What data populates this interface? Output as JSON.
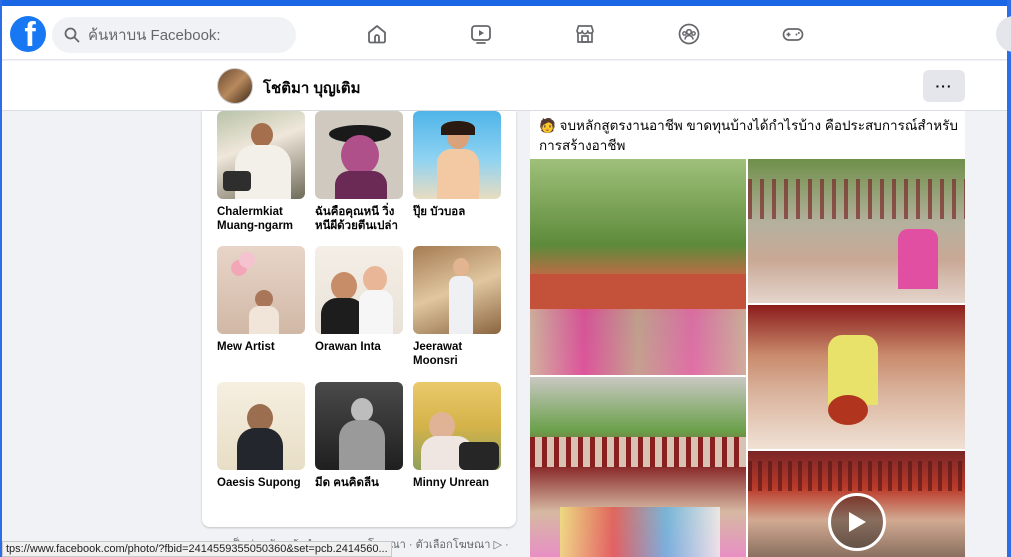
{
  "topbar": {
    "logo_letter": "f",
    "search_placeholder": "ค้นหาบน Facebook:",
    "nav_icons": [
      "home-icon",
      "watch-icon",
      "marketplace-icon",
      "groups-icon",
      "gaming-icon"
    ],
    "accent_color": "#1877f2"
  },
  "profile": {
    "name": "โชติมา บุญเติม",
    "more_label": "···"
  },
  "friends": [
    {
      "name": "Chalermkiat Muang-ngarm"
    },
    {
      "name": "ฉันคือคุณหนี วิ่งหนีผีด้วยตีนเปล่า"
    },
    {
      "name": "ปุ๊ย บัวบอล"
    },
    {
      "name": "Mew Artist"
    },
    {
      "name": "Orawan Inta"
    },
    {
      "name": "Jeerawat Moonsri"
    },
    {
      "name": "Oaesis Supong"
    },
    {
      "name": "มีด คนคิดลีน"
    },
    {
      "name": "Minny Unrean"
    }
  ],
  "footer": {
    "links_text": "ความเป็นส่วนตัว · ข้อกำหนด · การโฆษณา · ตัวเลือกโฆษณา ▷ ·"
  },
  "post": {
    "text": "🧑 จบหลักสูตรงานอาชีพ ขาดทุนบ้างได้กำไรบ้าง คือประสบการณ์สำหรับการสร้างอาชีพ"
  },
  "status_bar": {
    "url": "tps://www.facebook.com/photo/?fbid=2414559355050360&set=pcb.2414560..."
  }
}
